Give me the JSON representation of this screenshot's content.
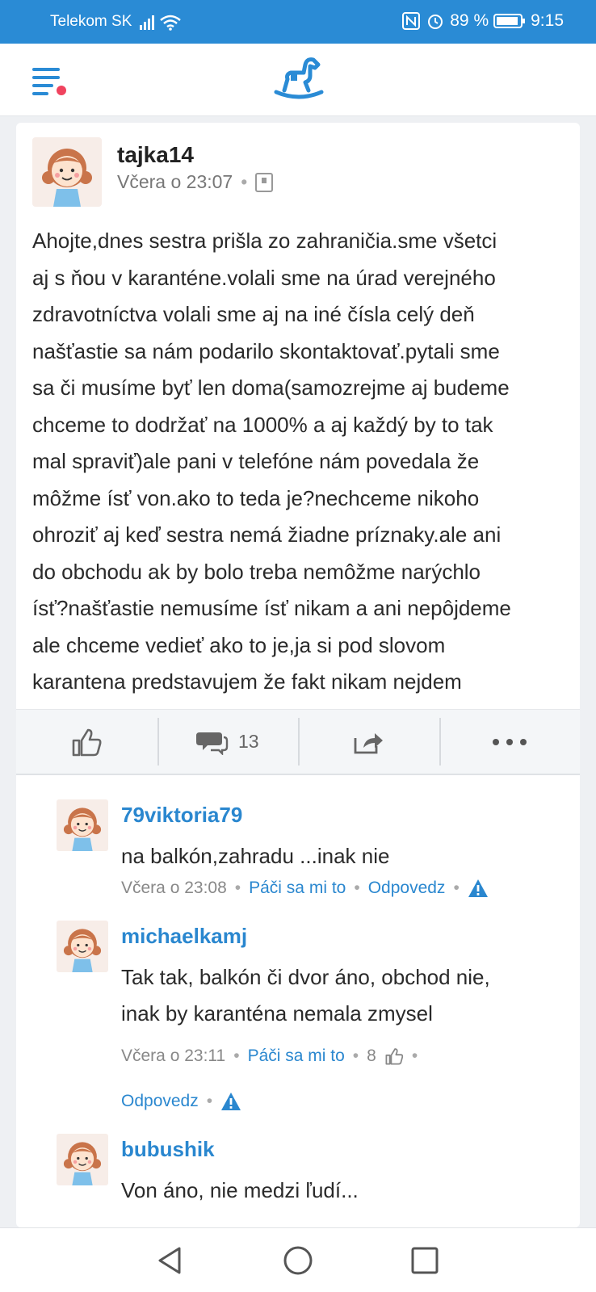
{
  "status_bar": {
    "carrier": "Telekom SK",
    "battery": "89 %",
    "time": "9:15"
  },
  "header": {
    "menu_icon": "hamburger-menu-icon",
    "logo_icon": "rocking-horse-logo"
  },
  "post": {
    "author": "tajka14",
    "time": "Včera o 23:07",
    "lines": [
      "Ahojte,dnes sestra prišla zo zahraničia.sme všetci",
      "aj s ňou v karanténe.volali sme na úrad verejného",
      "zdravotníctva volali sme aj na iné čísla celý deň",
      "našťastie sa nám podarilo skontaktovať.pytali sme",
      "sa či musíme byť len doma(samozrejme aj budeme",
      "chceme to dodržať na 1000% a aj každý by to tak",
      "mal spraviť)ale pani v telefóne nám povedala že",
      "môžme ísť von.ako to teda je?nechceme nikoho",
      "ohroziť aj keď sestra nemá žiadne príznaky.ale ani",
      "do obchodu ak by bolo treba nemôžme narýchlo",
      "ísť?našťastie nemusíme ísť nikam a ani nepôjdeme",
      "ale chceme vedieť ako to je,ja si pod slovom",
      "karantena predstavujem že fakt nikam nejdem"
    ],
    "comment_count": "13"
  },
  "comments": [
    {
      "author": "79viktoria79",
      "lines": [
        "na balkón,zahradu ...inak nie"
      ],
      "time": "Včera o 23:08",
      "like_label": "Páči sa mi to",
      "reply_label": "Odpovedz"
    },
    {
      "author": "michaelkamj",
      "lines": [
        "Tak tak, balkón či dvor áno, obchod nie,",
        "inak by karanténa nemala zmysel"
      ],
      "time": "Včera o 23:11",
      "like_label": "Páči sa mi to",
      "like_count": "8",
      "reply_label": "Odpovedz"
    },
    {
      "author": "bubushik",
      "lines": [
        "Von áno, nie medzi ľudí..."
      ]
    }
  ],
  "colors": {
    "brand_blue": "#2a8bd5",
    "link_blue": "#2a87cf",
    "notification_red": "#f0435e"
  }
}
